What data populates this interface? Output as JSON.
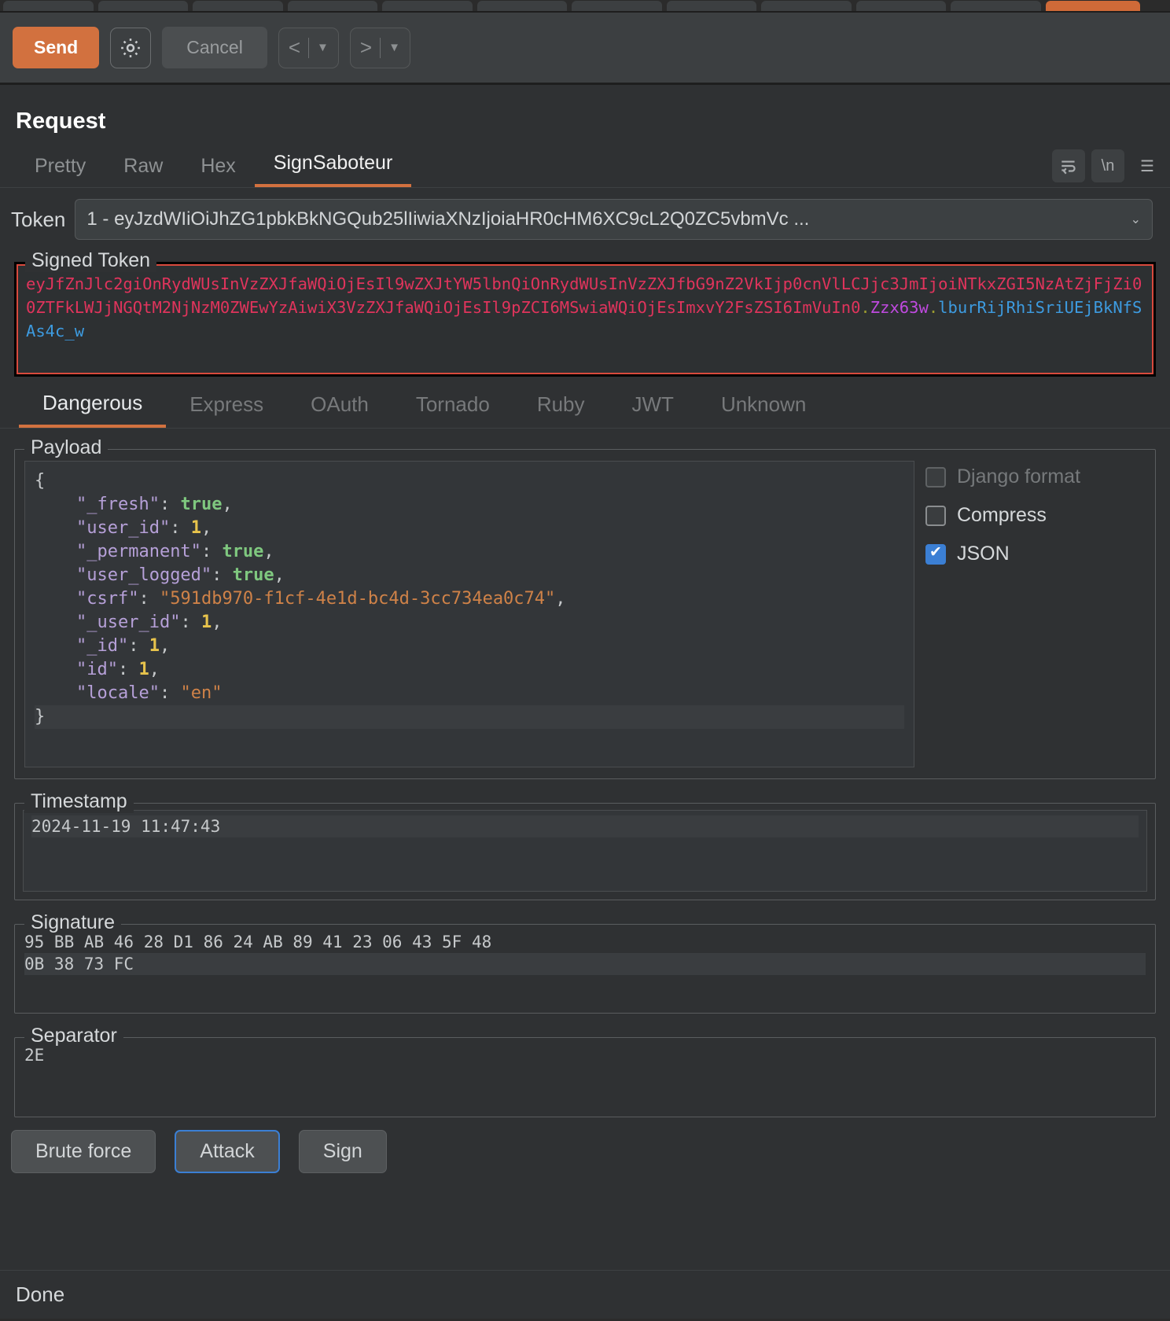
{
  "toolbar": {
    "send_label": "Send",
    "gear_icon": "gear-icon",
    "cancel_label": "Cancel",
    "prev_label": "<",
    "next_label": ">",
    "caret": "▼",
    "accent_color": "#d2713f"
  },
  "request": {
    "title": "Request",
    "view_tabs": [
      {
        "label": "Pretty",
        "active": false
      },
      {
        "label": "Raw",
        "active": false
      },
      {
        "label": "Hex",
        "active": false
      },
      {
        "label": "SignSaboteur",
        "active": true
      }
    ],
    "icons": [
      {
        "name": "word-wrap-icon",
        "glyph": "↵"
      },
      {
        "name": "newline-icon",
        "glyph": "\\n"
      },
      {
        "name": "menu-icon",
        "glyph": "☰"
      }
    ]
  },
  "token": {
    "label": "Token",
    "value": "1 - eyJzdWIiOiJhZG1pbkBkNGQub25lIiwiaXNzIjoiaHR0cHM6XC9cL2Q0ZC5vbmVc ...",
    "caret": "⌄"
  },
  "signed_token": {
    "legend": "Signed Token",
    "parts": [
      {
        "text": "eyJfZnJlc2giOnRydWUsInVzZXJfaWQiOjEsIl9wZXJtYW5lbnQiOnRydWUsInVzZXJfbG9nZ2VkIjp0cnVlLCJjc3JmIjoiNTkxZGI5NzAtZjFjZi00ZTFkLWJjNGQtM2NjNzM0ZWEwYzAiwiX3VzZXJfaWQiOjEsIl9pZCI6MSwiaWQiOjEsImxvY2FsZSI6ImVuIn0",
        "color": "red"
      },
      {
        "text": ".",
        "color": "dot"
      },
      {
        "text": "Zzx63w",
        "color": "purple"
      },
      {
        "text": ".",
        "color": "dot"
      },
      {
        "text": "lburRijRhiSriUEjBkNfSAs4c_w",
        "color": "blue"
      }
    ]
  },
  "algo_tabs": [
    {
      "label": "Dangerous",
      "active": true
    },
    {
      "label": "Express",
      "active": false
    },
    {
      "label": "OAuth",
      "active": false
    },
    {
      "label": "Tornado",
      "active": false
    },
    {
      "label": "Ruby",
      "active": false
    },
    {
      "label": "JWT",
      "active": false
    },
    {
      "label": "Unknown",
      "active": false
    }
  ],
  "payload": {
    "legend": "Payload",
    "lines": [
      [
        {
          "t": "{",
          "c": "p"
        }
      ],
      [
        {
          "t": "    ",
          "c": "p"
        },
        {
          "t": "\"_fresh\"",
          "c": "k"
        },
        {
          "t": ": ",
          "c": "p"
        },
        {
          "t": "true",
          "c": "b"
        },
        {
          "t": ",",
          "c": "p"
        }
      ],
      [
        {
          "t": "    ",
          "c": "p"
        },
        {
          "t": "\"user_id\"",
          "c": "k"
        },
        {
          "t": ": ",
          "c": "p"
        },
        {
          "t": "1",
          "c": "n"
        },
        {
          "t": ",",
          "c": "p"
        }
      ],
      [
        {
          "t": "    ",
          "c": "p"
        },
        {
          "t": "\"_permanent\"",
          "c": "k"
        },
        {
          "t": ": ",
          "c": "p"
        },
        {
          "t": "true",
          "c": "b"
        },
        {
          "t": ",",
          "c": "p"
        }
      ],
      [
        {
          "t": "    ",
          "c": "p"
        },
        {
          "t": "\"user_logged\"",
          "c": "k"
        },
        {
          "t": ": ",
          "c": "p"
        },
        {
          "t": "true",
          "c": "b"
        },
        {
          "t": ",",
          "c": "p"
        }
      ],
      [
        {
          "t": "    ",
          "c": "p"
        },
        {
          "t": "\"csrf\"",
          "c": "k"
        },
        {
          "t": ": ",
          "c": "p"
        },
        {
          "t": "\"591db970-f1cf-4e1d-bc4d-3cc734ea0c74\"",
          "c": "s"
        },
        {
          "t": ",",
          "c": "p"
        }
      ],
      [
        {
          "t": "    ",
          "c": "p"
        },
        {
          "t": "\"_user_id\"",
          "c": "k"
        },
        {
          "t": ": ",
          "c": "p"
        },
        {
          "t": "1",
          "c": "n"
        },
        {
          "t": ",",
          "c": "p"
        }
      ],
      [
        {
          "t": "    ",
          "c": "p"
        },
        {
          "t": "\"_id\"",
          "c": "k"
        },
        {
          "t": ": ",
          "c": "p"
        },
        {
          "t": "1",
          "c": "n"
        },
        {
          "t": ",",
          "c": "p"
        }
      ],
      [
        {
          "t": "    ",
          "c": "p"
        },
        {
          "t": "\"id\"",
          "c": "k"
        },
        {
          "t": ": ",
          "c": "p"
        },
        {
          "t": "1",
          "c": "n"
        },
        {
          "t": ",",
          "c": "p"
        }
      ],
      [
        {
          "t": "    ",
          "c": "p"
        },
        {
          "t": "\"locale\"",
          "c": "k"
        },
        {
          "t": ": ",
          "c": "p"
        },
        {
          "t": "\"en\"",
          "c": "s"
        }
      ],
      [
        {
          "t": "}",
          "c": "p",
          "hl": true
        }
      ]
    ],
    "options": [
      {
        "label": "Django format",
        "checked": false,
        "disabled": true
      },
      {
        "label": "Compress",
        "checked": false,
        "disabled": false
      },
      {
        "label": "JSON",
        "checked": true,
        "disabled": false
      }
    ]
  },
  "timestamp": {
    "legend": "Timestamp",
    "value": "2024-11-19 11:47:43"
  },
  "signature": {
    "legend": "Signature",
    "lines": [
      "95 BB AB 46 28 D1 86 24 AB 89 41 23 06 43 5F 48",
      "0B 38 73 FC"
    ]
  },
  "separator": {
    "legend": "Separator",
    "value": "2E"
  },
  "actions": [
    {
      "label": "Brute force",
      "focus": false
    },
    {
      "label": "Attack",
      "focus": true
    },
    {
      "label": "Sign",
      "focus": false
    }
  ],
  "status": {
    "text": "Done"
  }
}
